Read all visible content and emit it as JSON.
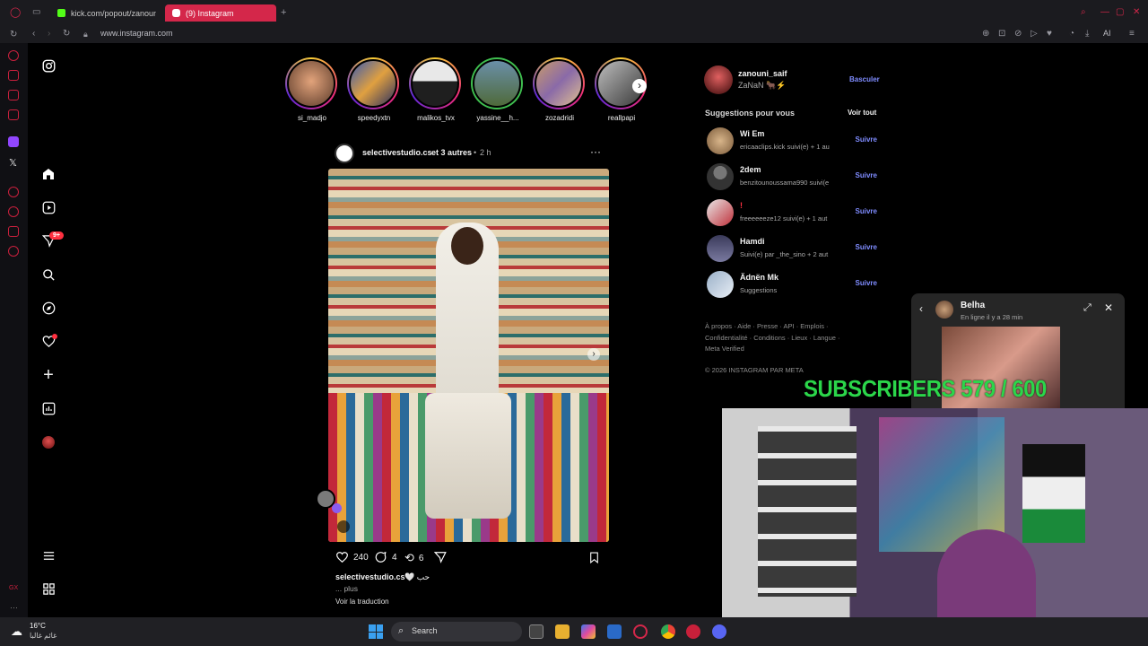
{
  "browser": {
    "tabs": [
      {
        "label": "kick.com/popout/zanoun"
      },
      {
        "label": "(9) Instagram"
      }
    ],
    "new_tab": "+",
    "url": "www.instagram.com",
    "ai_label": "AI"
  },
  "stories": [
    {
      "name": "si_madjo"
    },
    {
      "name": "speedyxtn"
    },
    {
      "name": "malikos_tvx"
    },
    {
      "name": "yassine__h..."
    },
    {
      "name": "zozadridi"
    },
    {
      "name": "reallpapi"
    }
  ],
  "nav": {
    "notification_badge": "9+"
  },
  "post": {
    "author": "selectivestudio.cs",
    "coauthors": "et 3 autres",
    "time": "2 h",
    "likes": "240",
    "comments": "4",
    "reposts": "6",
    "caption_user": "selectivestudio.cs",
    "caption_text": "🤍 حب",
    "more": "... plus",
    "translate": "Voir la traduction"
  },
  "profile": {
    "username": "zanouni_saif",
    "fullname": "ZaNaN 🐂⚡",
    "switch": "Basculer"
  },
  "suggestions": {
    "title": "Suggestions pour vous",
    "see_all": "Voir tout",
    "follow": "Suivre",
    "items": [
      {
        "name": "Wi Em",
        "sub": "ericaaclips.kick suivi(e) + 1 au"
      },
      {
        "name": "2dem",
        "sub": "benzitounoussama990 suivi(e"
      },
      {
        "name": "!",
        "sub": "freeeeeeze12 suivi(e) + 1 aut"
      },
      {
        "name": "Hamdi",
        "sub": "Suivi(e) par _the_sino + 2 aut"
      },
      {
        "name": "Ädnën Mk",
        "sub": "Suggestions"
      }
    ]
  },
  "footer": {
    "line1": "À propos · Aide · Presse · API · Emplois ·",
    "line2": "Confidentialité · Conditions · Lieux · Langue ·",
    "line3": "Meta Verified",
    "copyright": "© 2026 INSTAGRAM PAR META"
  },
  "chat": {
    "name": "Belha",
    "status": "En ligne il y a 28 min"
  },
  "overlay": {
    "subscribers": "SUBSCRIBERS 579 / 600"
  },
  "taskbar": {
    "temp": "16°C",
    "weather": "غائم غالبا",
    "search": "Search"
  },
  "colors": {
    "accent": "#d4274a",
    "link": "#7f8cff",
    "overlay_text": "#2bd64a"
  }
}
